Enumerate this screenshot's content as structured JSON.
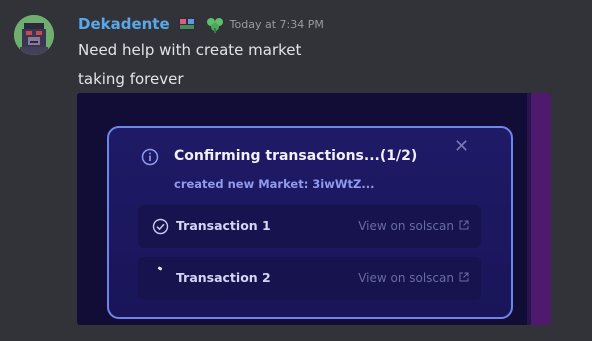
{
  "message": {
    "username": "Dekadente",
    "timestamp": "Today at 7:34 PM",
    "lines": [
      "Need help with create market",
      "taking forever"
    ]
  },
  "modal": {
    "title": "Confirming transactions...(1/2)",
    "subtitle": "created new Market: 3iwWtZ...",
    "transactions": [
      {
        "label": "Transaction 1",
        "link": "View on solscan",
        "status": "confirmed"
      },
      {
        "label": "Transaction 2",
        "link": "View on solscan",
        "status": "pending"
      }
    ]
  },
  "colors": {
    "username": "#5aa8e8",
    "modal_border": "#6d86ea",
    "subtitle": "#8f9bf0"
  }
}
